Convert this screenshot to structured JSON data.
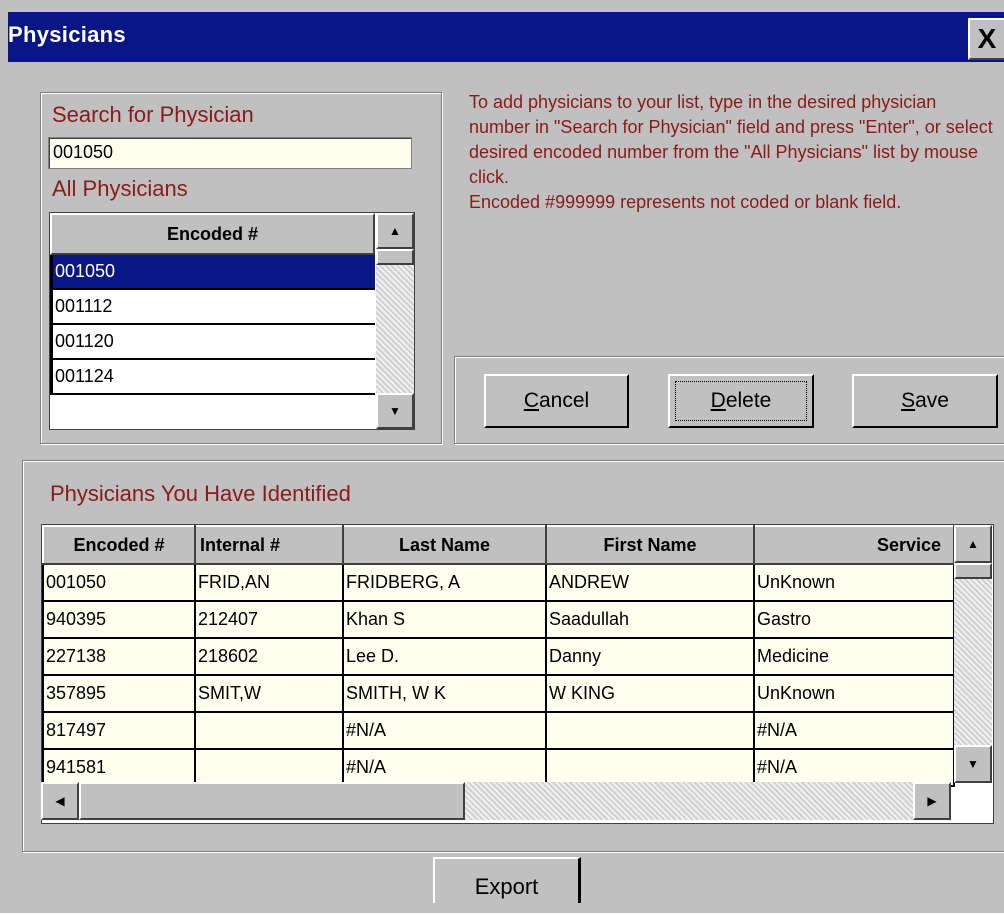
{
  "window": {
    "title": "Physicians",
    "close_label": "X"
  },
  "search": {
    "label": "Search for Physician",
    "value": "001050"
  },
  "all_physicians": {
    "label": "All Physicians",
    "column_header": "Encoded #",
    "items": [
      "001050",
      "001112",
      "001120",
      "001124"
    ],
    "selected": "001050"
  },
  "instructions": {
    "line1": "To add physicians to your list, type in the desired physician number in \"Search for Physician\" field and press \"Enter\", or select desired encoded number from the \"All Physicians\" list by mouse click.",
    "line2": "Encoded #999999 represents not coded or blank field."
  },
  "buttons": {
    "cancel": "Cancel",
    "delete": "Delete",
    "save": "Save",
    "export": "Export"
  },
  "identified": {
    "label": "Physicians You Have Identified",
    "columns": [
      "Encoded #",
      "Internal #",
      "Last Name",
      "First Name",
      "Service"
    ],
    "rows": [
      [
        "001050",
        "FRID,AN",
        "FRIDBERG, A",
        "ANDREW",
        "UnKnown"
      ],
      [
        "940395",
        "212407",
        "Khan S",
        "Saadullah",
        "Gastro"
      ],
      [
        "227138",
        "218602",
        "Lee D.",
        "Danny",
        "Medicine"
      ],
      [
        "357895",
        "SMIT,W",
        "SMITH, W K",
        "W KING",
        "UnKnown"
      ],
      [
        "817497",
        "",
        "#N/A",
        "",
        "#N/A"
      ],
      [
        "941581",
        "",
        "#N/A",
        "",
        "#N/A"
      ]
    ]
  }
}
